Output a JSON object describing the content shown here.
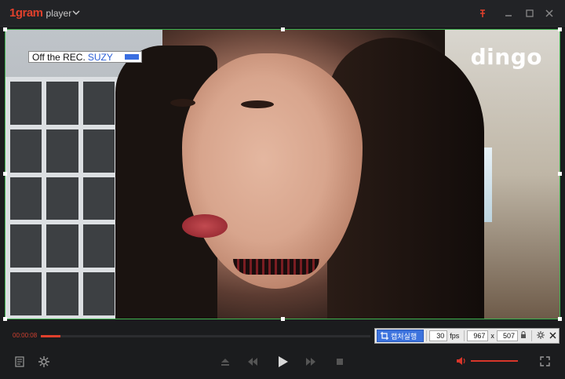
{
  "app": {
    "brand": "1gram",
    "suffix": "player"
  },
  "video": {
    "overlay_title_plain": "Off the REC.",
    "overlay_title_accent": "SUZY",
    "watermark": "dingo"
  },
  "playback": {
    "current_time": "00:00:08",
    "progress_fraction": 0.06
  },
  "capture": {
    "run_label": "캡처실행",
    "fps_value": "30",
    "fps_unit": "fps",
    "width": "967",
    "separator": "x",
    "height": "507"
  },
  "volume": {
    "level_fraction": 1.0
  },
  "colors": {
    "accent": "#e0402c",
    "selection": "#3fb34f",
    "capture_button": "#3c73de"
  }
}
